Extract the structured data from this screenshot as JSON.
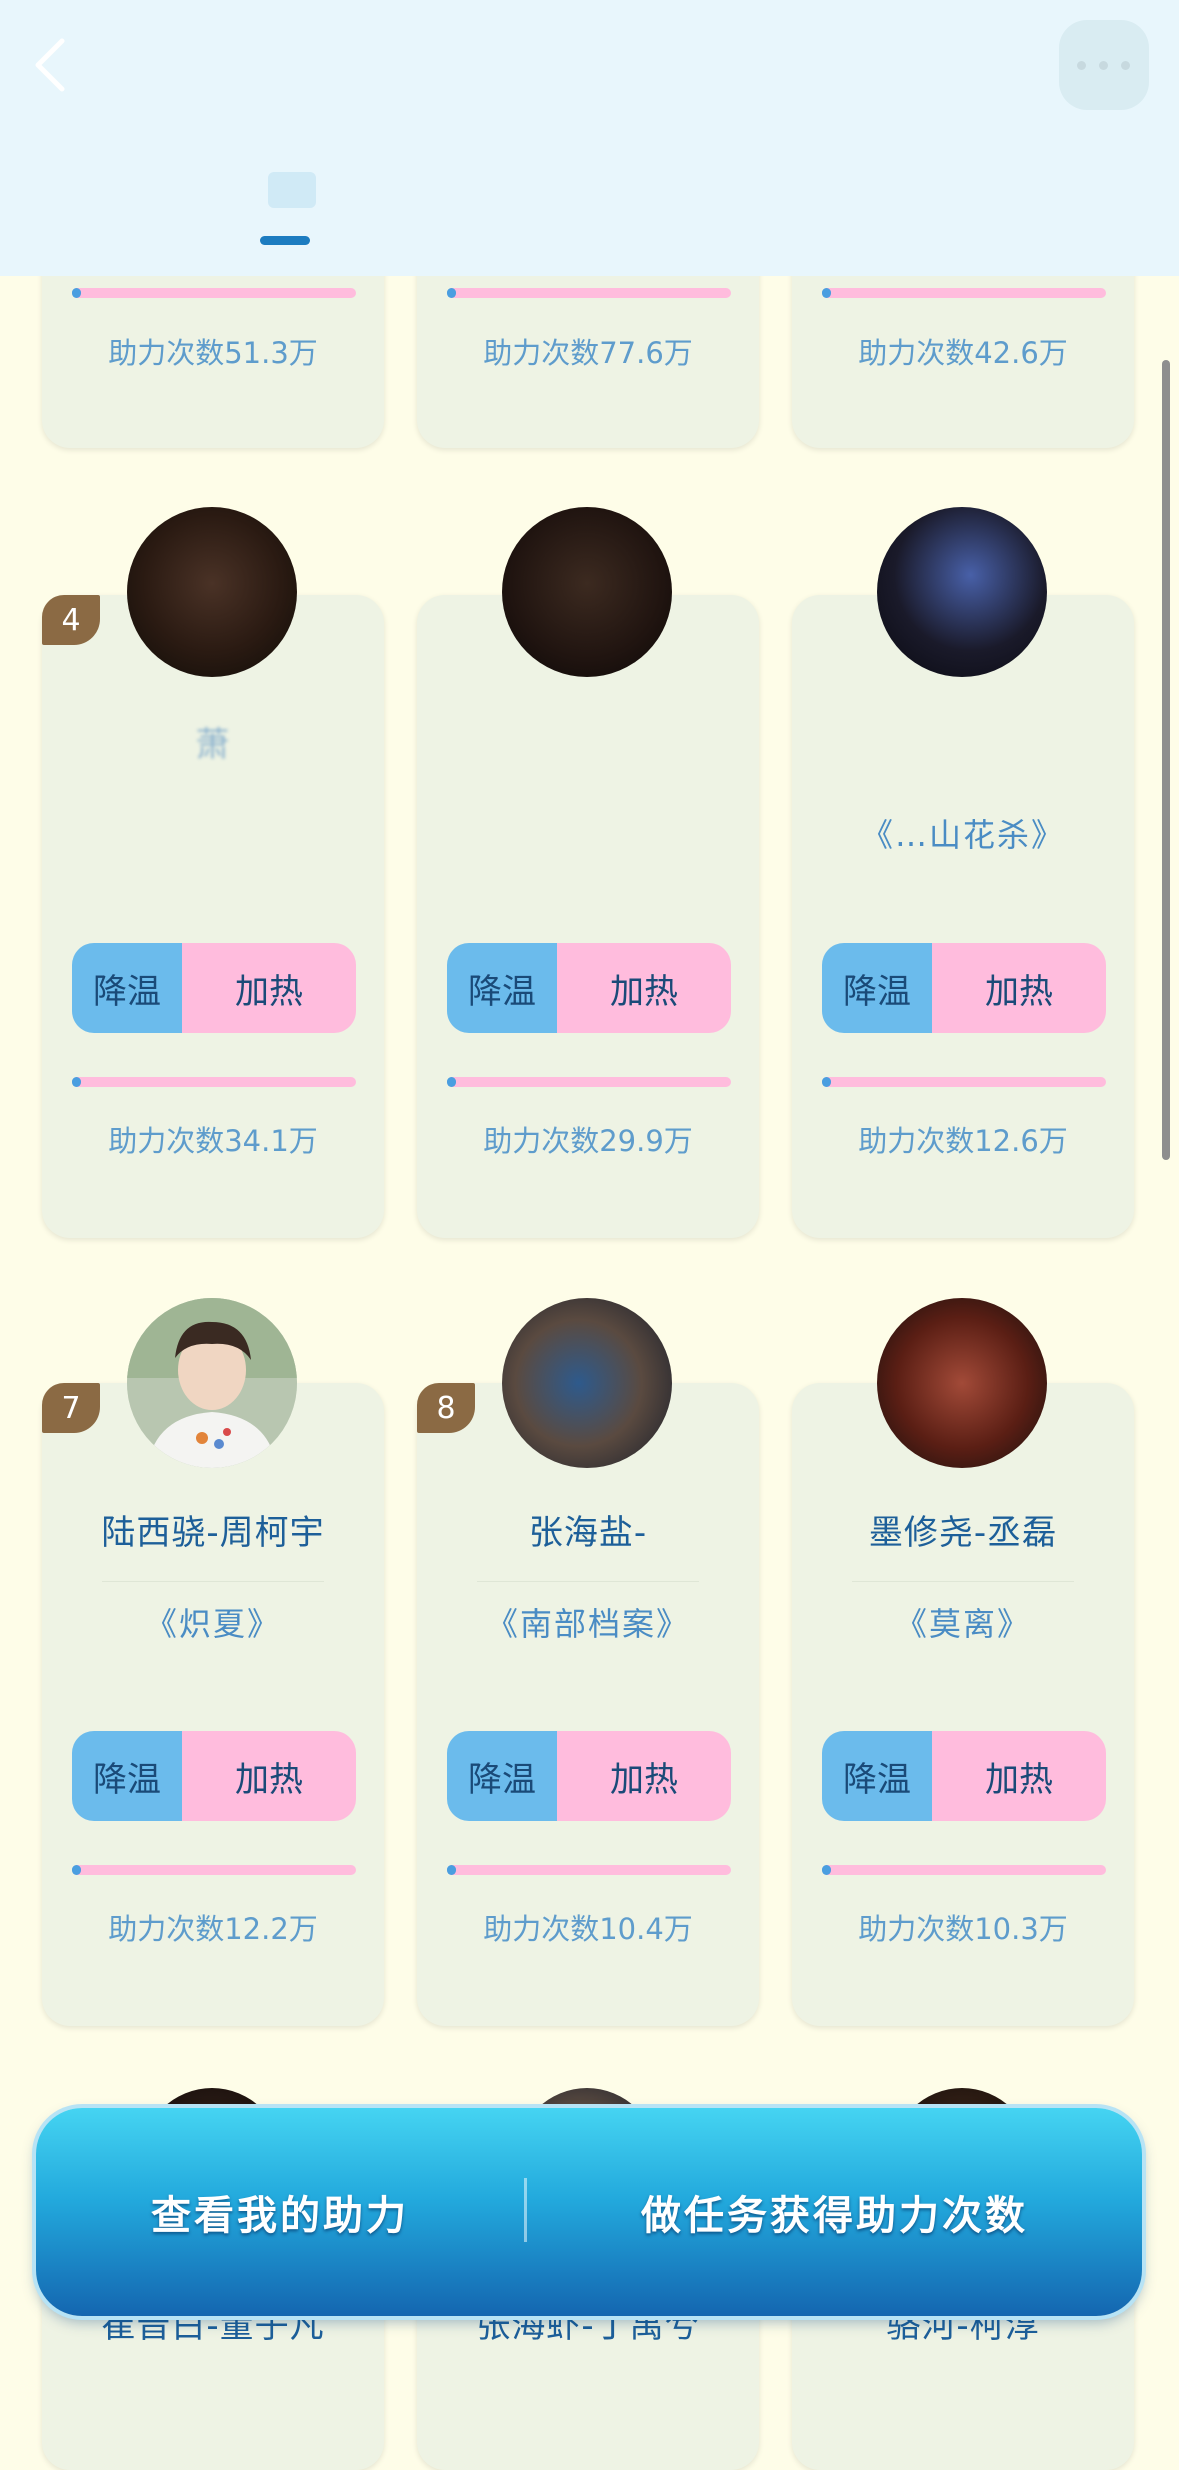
{
  "labels": {
    "cool": "降温",
    "heat": "加热"
  },
  "top_row": [
    {
      "count": "助力次数51.3万",
      "progress": 0.03
    },
    {
      "count": "助力次数77.6万",
      "progress": 0.03
    },
    {
      "count": "助力次数42.6万",
      "progress": 0.03
    }
  ],
  "row2": [
    {
      "rank": "4",
      "name": "萧",
      "drama": "",
      "count": "助力次数34.1万",
      "progress": 0.03
    },
    {
      "rank": "",
      "name": "",
      "drama": "",
      "count": "助力次数29.9万",
      "progress": 0.03
    },
    {
      "rank": "",
      "name": "",
      "drama": "《…山花杀》",
      "count": "助力次数12.6万",
      "progress": 0.03
    }
  ],
  "row3": [
    {
      "rank": "7",
      "name": "陆西骁-周柯宇",
      "drama": "《炽夏》",
      "count": "助力次数12.2万",
      "progress": 0.03
    },
    {
      "rank": "8",
      "name": "张海盐-",
      "drama": "《南部档案》",
      "count": "助力次数10.4万",
      "progress": 0.03
    },
    {
      "rank": "",
      "name": "墨修尧-丞磊",
      "drama": "《莫离》",
      "count": "助力次数10.3万",
      "progress": 0.03
    }
  ],
  "row4": [
    {
      "name": "崔晋白-董子凡"
    },
    {
      "name": "张海虾-丁禹兮"
    },
    {
      "name": "骆河-柯淳"
    }
  ],
  "bottom_bar": {
    "view_label": "查看我的助力",
    "task_label": "做任务获得助力次数"
  }
}
